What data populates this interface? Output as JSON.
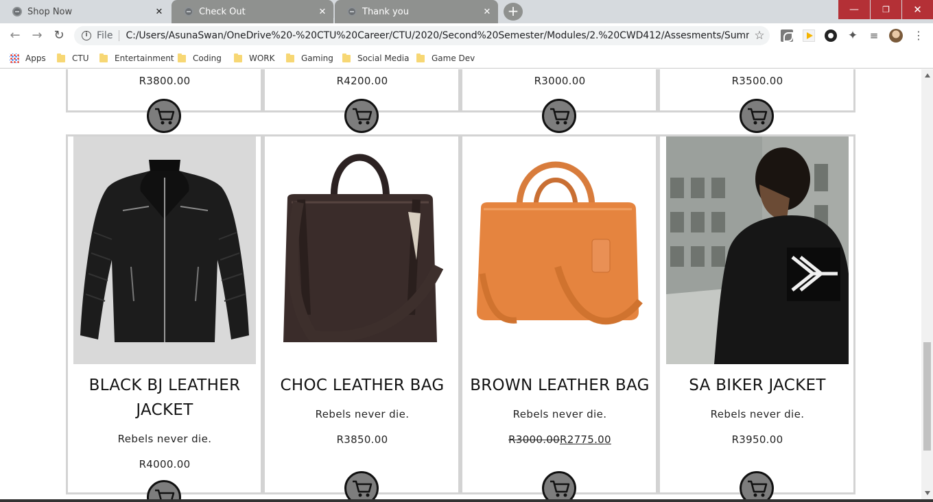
{
  "browser": {
    "tabs": [
      {
        "title": "Shop Now",
        "close": "✕"
      },
      {
        "title": "Check Out",
        "close": "✕"
      },
      {
        "title": "Thank you",
        "close": "✕"
      }
    ],
    "new_tab": "+",
    "window_controls": {
      "minimize": "—",
      "maximize": "❐",
      "close": "✕"
    },
    "nav": {
      "back": "←",
      "forward": "→",
      "reload": "↻"
    },
    "address": {
      "info_icon": "i",
      "scheme_label": "File",
      "url": "C:/Users/AsunaSwan/OneDrive%20-%20CTU%20Career/CTU/2020/Second%20Semester/Modules/2.%20CWD412/Assesments/Summitives/Code..."
    },
    "star": "☆",
    "menu": "⋮",
    "puzzle": "✦",
    "media": "≡",
    "bookmarks": [
      "Apps",
      "CTU",
      "Entertainment",
      "Coding",
      "WORK",
      "Gaming",
      "Social Media",
      "Game Dev"
    ]
  },
  "products_top_row": [
    {
      "price": "R3800.00"
    },
    {
      "price": "R4200.00"
    },
    {
      "price": "R3000.00"
    },
    {
      "price": "R3500.00"
    }
  ],
  "products": [
    {
      "name": "BLACK BJ LEATHER JACKET",
      "description": "Rebels never die.",
      "price": "R4000.00",
      "image": "black-leather-jacket-photo"
    },
    {
      "name": "CHOC LEATHER BAG",
      "description": "Rebels never die.",
      "price": "R3850.00",
      "image": "brown-leather-bag-photo"
    },
    {
      "name": "BROWN LEATHER BAG",
      "description": "Rebels never die.",
      "old_price": "R3000.00",
      "sale_price": "R2775.00",
      "image": "tan-leather-bag-photo"
    },
    {
      "name": "SA BIKER JACKET",
      "description": "Rebels never die.",
      "price": "R3950.00",
      "image": "man-in-biker-jacket-photo"
    }
  ],
  "colors": {
    "border": "#d3d3d3",
    "cart_fill": "#7d7d7d",
    "chrome_tab_active": "#8f918f",
    "window_controls": "#b43036"
  },
  "icons": [
    "globe-icon",
    "cart-icon",
    "star-icon",
    "puzzle-icon",
    "folder-icon",
    "apps-icon"
  ]
}
